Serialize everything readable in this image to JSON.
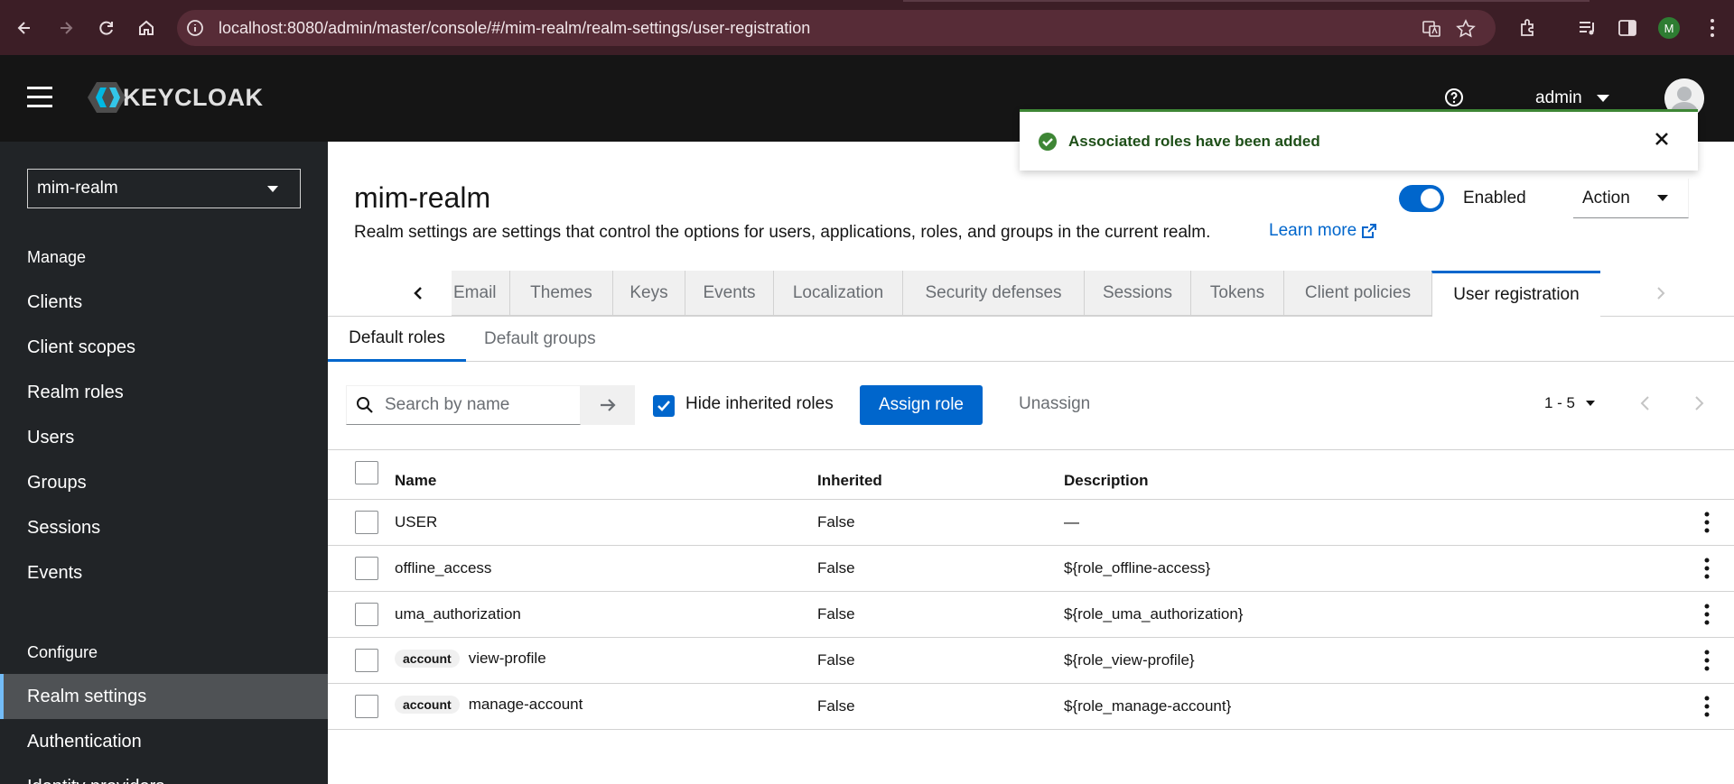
{
  "browser": {
    "url": "localhost:8080/admin/master/console/#/mim-realm/realm-settings/user-registration",
    "profile_initial": "M"
  },
  "header": {
    "logo_text": "KEYCLOAK",
    "user": "admin"
  },
  "sidebar": {
    "realm": "mim-realm",
    "manage_label": "Manage",
    "manage_items": [
      "Clients",
      "Client scopes",
      "Realm roles",
      "Users",
      "Groups",
      "Sessions",
      "Events"
    ],
    "configure_label": "Configure",
    "configure_items": [
      "Realm settings",
      "Authentication",
      "Identity providers"
    ],
    "active_item": "Realm settings"
  },
  "page": {
    "title": "mim-realm",
    "description": "Realm settings are settings that control the options for users, applications, roles, and groups in the current realm.",
    "learn_more": "Learn more",
    "enabled_label": "Enabled",
    "action_label": "Action"
  },
  "tabs": [
    "Email",
    "Themes",
    "Keys",
    "Events",
    "Localization",
    "Security defenses",
    "Sessions",
    "Tokens",
    "Client policies",
    "User registration"
  ],
  "active_tab": "User registration",
  "subtabs": [
    "Default roles",
    "Default groups"
  ],
  "toolbar": {
    "search_placeholder": "Search by name",
    "hide_inherited": "Hide inherited roles",
    "assign_role": "Assign role",
    "unassign": "Unassign",
    "pagination": "1 - 5"
  },
  "table": {
    "columns": [
      "Name",
      "Inherited",
      "Description"
    ],
    "rows": [
      {
        "client": "",
        "name": "USER",
        "inherited": "False",
        "description": "—"
      },
      {
        "client": "",
        "name": "offline_access",
        "inherited": "False",
        "description": "${role_offline-access}"
      },
      {
        "client": "",
        "name": "uma_authorization",
        "inherited": "False",
        "description": "${role_uma_authorization}"
      },
      {
        "client": "account",
        "name": "view-profile",
        "inherited": "False",
        "description": "${role_view-profile}"
      },
      {
        "client": "account",
        "name": "manage-account",
        "inherited": "False",
        "description": "${role_manage-account}"
      }
    ]
  },
  "toast": {
    "message": "Associated roles have been added",
    "color": "#3e8635"
  },
  "colors": {
    "primary": "#0066cc",
    "header_bg": "#151515",
    "sidebar_bg": "#212427",
    "chrome_bg": "#3c1e26"
  }
}
